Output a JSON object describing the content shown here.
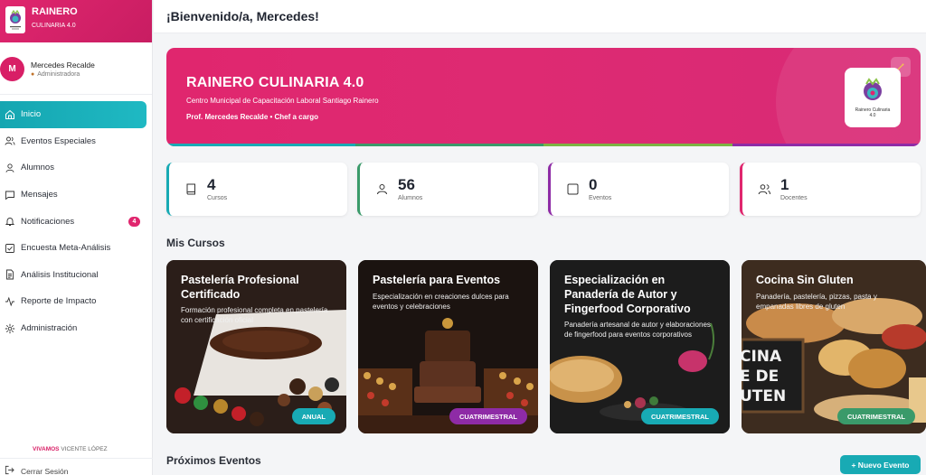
{
  "brand": {
    "name": "RAINERO",
    "subtitle": "CULINARIA 4.0"
  },
  "user": {
    "initial": "M",
    "name": "Mercedes Recalde",
    "role": "Administradora"
  },
  "nav": [
    {
      "label": "Inicio",
      "icon": "home-icon",
      "active": true
    },
    {
      "label": "Eventos Especiales",
      "icon": "users-icon"
    },
    {
      "label": "Alumnos",
      "icon": "user-icon"
    },
    {
      "label": "Mensajes",
      "icon": "message-icon"
    },
    {
      "label": "Notificaciones",
      "icon": "bell-icon",
      "badge": "4"
    },
    {
      "label": "Encuesta Meta-Análisis",
      "icon": "checkbox-icon"
    },
    {
      "label": "Análisis Institucional",
      "icon": "document-icon"
    },
    {
      "label": "Reporte de Impacto",
      "icon": "activity-icon"
    },
    {
      "label": "Administración",
      "icon": "settings-icon"
    }
  ],
  "footer": {
    "vivamos": "VIVAMOS",
    "vicente": "VICENTE LÓPEZ",
    "logout": "Cerrar Sesión"
  },
  "header": {
    "greeting": "¡Bienvenido/a, Mercedes!"
  },
  "hero": {
    "title": "RAINERO CULINARIA 4.0",
    "subtitle": "Centro Municipal de Capacitación Laboral Santiago Rainero",
    "chef": "Prof. Mercedes Recalde • Chef a cargo",
    "logo_text": "Rainero Culinaria\n4.0"
  },
  "colors": {
    "pink": "#e0266e",
    "teal": "#18aab4",
    "green": "#3a9a6a",
    "purple": "#8e2ba6",
    "olive": "#7cb342"
  },
  "stats": [
    {
      "value": "4",
      "label": "Cursos",
      "icon": "book-icon",
      "color": "#18aab4"
    },
    {
      "value": "56",
      "label": "Alumnos",
      "icon": "user-icon",
      "color": "#3a9a6a"
    },
    {
      "value": "0",
      "label": "Eventos",
      "icon": "square-icon",
      "color": "#8e2ba6"
    },
    {
      "value": "1",
      "label": "Docentes",
      "icon": "users-icon",
      "color": "#e0266e"
    }
  ],
  "sections": {
    "courses": "Mis Cursos",
    "events": "Próximos Eventos",
    "new_event": "+ Nuevo Evento"
  },
  "courses": [
    {
      "title": "Pastelería Profesional Certificado",
      "desc": "Formación profesional completa en pastelería con certificación oficial",
      "tag": "ANUAL",
      "tag_color": "#18aab4"
    },
    {
      "title": "Pastelería para Eventos",
      "desc": "Especialización en creaciones dulces para eventos y celebraciones",
      "tag": "CUATRIMESTRAL",
      "tag_color": "#8e2ba6"
    },
    {
      "title": "Especialización en Panadería de Autor y Fingerfood Corporativo",
      "desc": "Panadería artesanal de autor y elaboraciones de fingerfood para eventos corporativos",
      "tag": "CUATRIMESTRAL",
      "tag_color": "#18aab4"
    },
    {
      "title": "Cocina Sin Gluten",
      "desc": "Panadería, pastelería, pizzas, pasta y empanadas libres de gluten",
      "tag": "CUATRIMESTRAL",
      "tag_color": "#3a9a6a"
    }
  ],
  "course_art": {
    "board_text": [
      "CINA",
      "E DE",
      "UTEN"
    ]
  }
}
